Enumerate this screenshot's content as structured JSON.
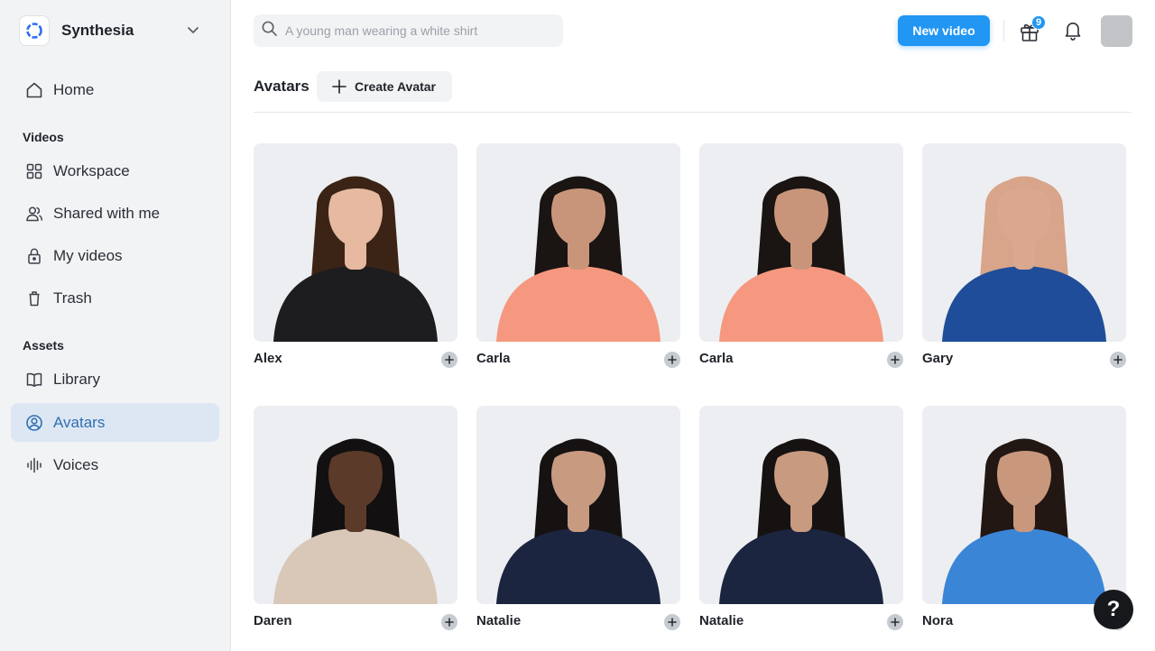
{
  "brand": {
    "name": "Synthesia",
    "accent": "#2196f3"
  },
  "sidebar": {
    "home": "Home",
    "videos_section": "Videos",
    "workspace": "Workspace",
    "shared": "Shared with me",
    "my_videos": "My videos",
    "trash": "Trash",
    "assets_section": "Assets",
    "library": "Library",
    "avatars": "Avatars",
    "voices": "Voices",
    "active_item": "Avatars"
  },
  "search": {
    "placeholder": "A young man wearing a white shirt",
    "value": ""
  },
  "topbar": {
    "new_video": "New video",
    "gift_count": "9",
    "help": "?"
  },
  "header": {
    "title": "Avatars",
    "create": "Create Avatar"
  },
  "avatars": [
    {
      "name": "Alex",
      "hair": "#3b2416",
      "skin": "#e6b9a0",
      "top": "#1d1d1f",
      "bg": "#eceef1"
    },
    {
      "name": "Carla",
      "hair": "#1a1412",
      "skin": "#c9957a",
      "top": "#f5987f",
      "bg": "#eceef1"
    },
    {
      "name": "Carla",
      "hair": "#1a1412",
      "skin": "#c9957a",
      "top": "#f5987f",
      "bg": "#eceef1"
    },
    {
      "name": "Gary",
      "hair": "#d8a48a",
      "skin": "#d9a88e",
      "top": "#1f4d99",
      "bg": "#eceef1"
    },
    {
      "name": "Daren",
      "hair": "#121010",
      "skin": "#5b3a2a",
      "top": "#d9c8b8",
      "bg": "#eceef1"
    },
    {
      "name": "Natalie",
      "hair": "#161212",
      "skin": "#c89a80",
      "top": "#1c2540",
      "bg": "#eceef1"
    },
    {
      "name": "Natalie",
      "hair": "#161212",
      "skin": "#c89a80",
      "top": "#1c2540",
      "bg": "#eceef1"
    },
    {
      "name": "Nora",
      "hair": "#221713",
      "skin": "#c9977c",
      "top": "#3b85d6",
      "bg": "#eceef1"
    }
  ]
}
